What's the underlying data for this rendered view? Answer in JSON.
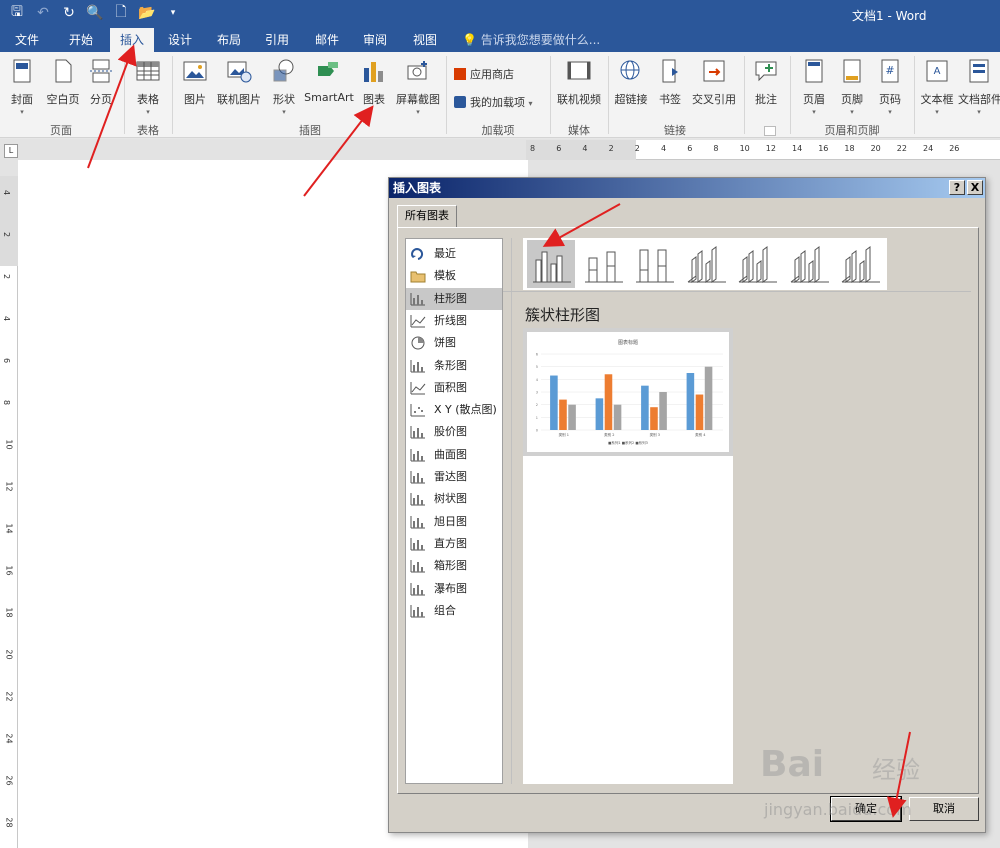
{
  "window": {
    "title": "文档1 - Word"
  },
  "quick_access": [
    "save-icon",
    "undo-icon",
    "redo-icon",
    "print-preview-icon",
    "new-doc-icon",
    "open-icon",
    "customize-icon"
  ],
  "tabs": [
    "文件",
    "开始",
    "插入",
    "设计",
    "布局",
    "引用",
    "邮件",
    "审阅",
    "视图"
  ],
  "active_tab": "插入",
  "tell_me": "告诉我您想要做什么...",
  "ribbon": {
    "pages": {
      "cover": "封面",
      "blank": "空白页",
      "break": "分页",
      "group": "页面"
    },
    "tables": {
      "table": "表格",
      "group": "表格"
    },
    "illustrations": {
      "picture": "图片",
      "online_picture": "联机图片",
      "shapes": "形状",
      "smartart": "SmartArt",
      "chart": "图表",
      "screenshot": "屏幕截图",
      "group": "插图"
    },
    "addins": {
      "store": "应用商店",
      "my_addins": "我的加载项",
      "group": "加载项"
    },
    "media": {
      "online_video": "联机视频",
      "group": "媒体"
    },
    "links": {
      "hyperlink": "超链接",
      "bookmark": "书签",
      "cross_ref": "交叉引用",
      "group": "链接"
    },
    "comments": {
      "comment": "批注"
    },
    "header_footer": {
      "header": "页眉",
      "footer": "页脚",
      "page_number": "页码",
      "group": "页眉和页脚"
    },
    "text": {
      "textbox": "文本框",
      "doc_parts": "文档部件"
    }
  },
  "ruler": {
    "h_ticks": [
      "8",
      "6",
      "4",
      "2",
      "2",
      "4",
      "6",
      "8",
      "10",
      "12",
      "14",
      "16",
      "18",
      "20",
      "22",
      "24",
      "26"
    ],
    "v_ticks": [
      "4",
      "2",
      "2",
      "4",
      "6",
      "8",
      "10",
      "12",
      "14",
      "16",
      "18",
      "20",
      "22",
      "24",
      "26",
      "28"
    ],
    "tab_marker": "L"
  },
  "dialog": {
    "title": "插入图表",
    "help": "?",
    "close": "X",
    "tab": "所有图表",
    "categories": [
      "最近",
      "模板",
      "柱形图",
      "折线图",
      "饼图",
      "条形图",
      "面积图",
      "X Y (散点图)",
      "股价图",
      "曲面图",
      "雷达图",
      "树状图",
      "旭日图",
      "直方图",
      "箱形图",
      "瀑布图",
      "组合"
    ],
    "selected_category": "柱形图",
    "subtype_title": "簇状柱形图",
    "ok": "确定",
    "cancel": "取消"
  },
  "preview": {
    "chart_title": "图表标题",
    "legend": "■系列1  ■系列2  ■系列3",
    "colors": {
      "series1": "#5b9bd5",
      "series2": "#ed7d31",
      "series3": "#a5a5a5"
    }
  },
  "chart_data": {
    "type": "bar",
    "title": "图表标题",
    "categories": [
      "类别 1",
      "类别 2",
      "类别 3",
      "类别 4"
    ],
    "series": [
      {
        "name": "系列1",
        "values": [
          4.3,
          2.5,
          3.5,
          4.5
        ]
      },
      {
        "name": "系列2",
        "values": [
          2.4,
          4.4,
          1.8,
          2.8
        ]
      },
      {
        "name": "系列3",
        "values": [
          2,
          2,
          3,
          5
        ]
      }
    ],
    "ylim": [
      0,
      6
    ],
    "yticks": [
      "0",
      "1",
      "2",
      "3",
      "4",
      "5",
      "6"
    ],
    "legend": "bottom"
  },
  "watermark": {
    "brand": "Bai",
    "brand2": "经验",
    "url": "jingyan.baidu.com"
  },
  "accent": "#2b579a",
  "arrow_color": "#e02020"
}
